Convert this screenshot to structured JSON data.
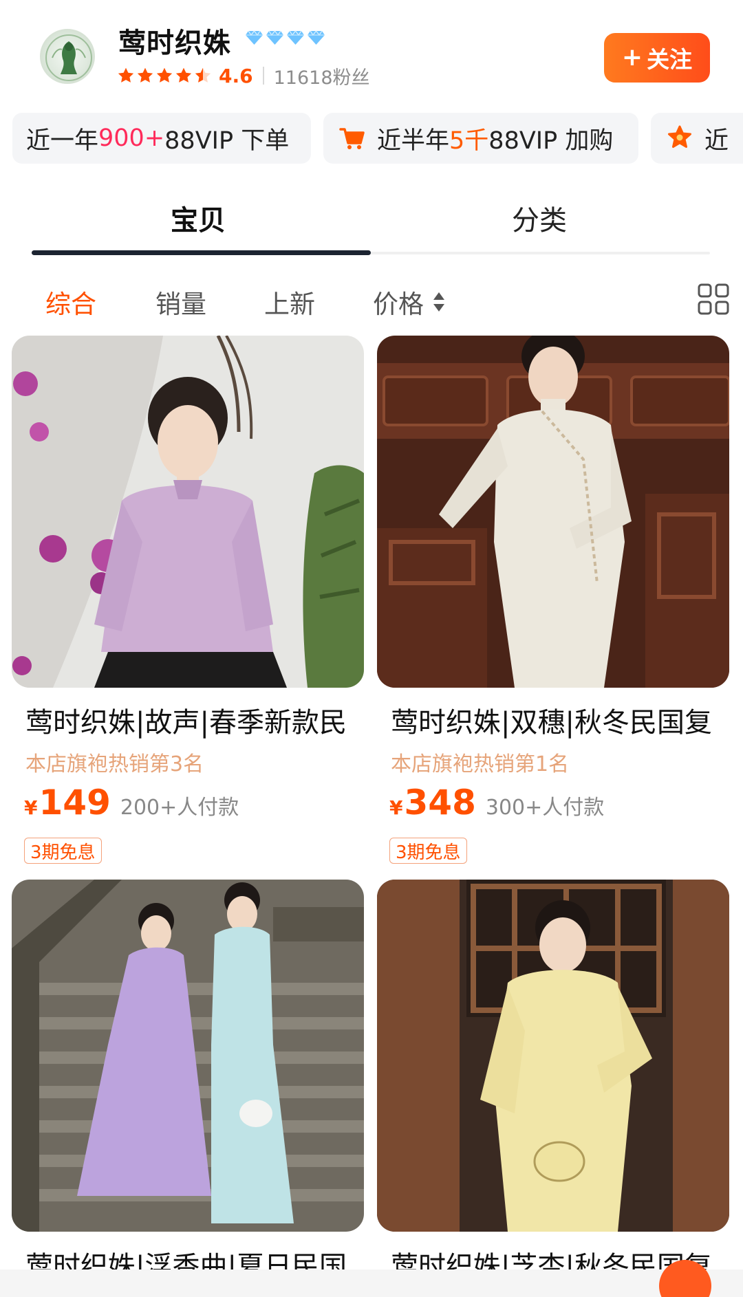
{
  "shop": {
    "name": "莺时织姝",
    "rating": "4.6",
    "fans": "11618粉丝",
    "follow_label": "关注",
    "colors": {
      "accent": "#ff5000",
      "star": "#ff5000",
      "diamond": "#6ec3ff"
    },
    "diamond_count": 4
  },
  "badges": [
    {
      "prefix": "近一年",
      "highlight": "900+",
      "suffix": "88VIP 下单",
      "icon": ""
    },
    {
      "prefix": "近半年",
      "highlight": "5千",
      "suffix": "88VIP 加购",
      "icon": "cart-icon"
    },
    {
      "prefix": "近",
      "highlight": "",
      "suffix": "",
      "icon": "flower-badge-icon"
    }
  ],
  "tabs": [
    {
      "label": "宝贝",
      "active": true
    },
    {
      "label": "分类",
      "active": false
    }
  ],
  "sort": {
    "items": [
      "综合",
      "销量",
      "上新",
      "价格"
    ],
    "active_index": 0
  },
  "products": [
    {
      "title": "莺时织姝|故声|春季新款民",
      "rank": "本店旗袍热销第3名",
      "currency": "¥",
      "price": "149",
      "sold": "200+人付款",
      "tag": "3期免息"
    },
    {
      "title": "莺时织姝|双穗|秋冬民国复",
      "rank": "本店旗袍热销第1名",
      "currency": "¥",
      "price": "348",
      "sold": "300+人付款",
      "tag": "3期免息"
    },
    {
      "title": "莺时织姝|浮香曲|夏日民国",
      "rank": "",
      "currency": "",
      "price": "",
      "sold": "",
      "tag": ""
    },
    {
      "title": "莺时织姝|芝杏|秋冬民国复",
      "rank": "",
      "currency": "",
      "price": "",
      "sold": "",
      "tag": ""
    }
  ]
}
